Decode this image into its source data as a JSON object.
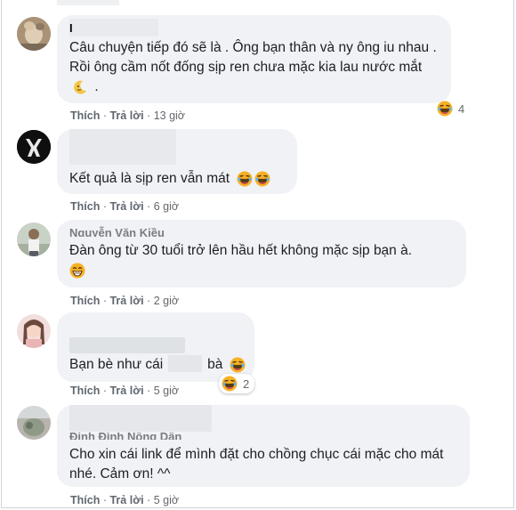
{
  "comments": [
    {
      "name": "I",
      "text": "Câu chuyện tiếp đó sẽ là . Ông bạn thân và ny ông iu nhau . Rồi ông cầm nốt đống sịp ren chưa mặc kia lau nước mắt",
      "text_after": ".",
      "like": "Thích",
      "reply": "Trả lời",
      "time": "13 giờ",
      "reaction_count": "4"
    },
    {
      "text": "Kết quả là sịp ren vẫn mát",
      "like": "Thích",
      "reply": "Trả lời",
      "time": "6 giờ"
    },
    {
      "name": "Nguyễn Văn Kiều",
      "text": "Đàn ông từ 30 tuổi trở lên hầu hết không mặc sịp bạn à.",
      "like": "Thích",
      "reply": "Trả lời",
      "time": "2 giờ"
    },
    {
      "text_before": "Bạn bè như cái",
      "text_after": "bà",
      "like": "Thích",
      "reply": "Trả lời",
      "time": "5 giờ",
      "reaction_count": "2"
    },
    {
      "name": "Đinh Đình Nông Dân",
      "text": "Cho xin cái link để mình đặt cho chồng chục cái mặc cho mát nhé. Cảm ơn! ^^",
      "like": "Thích",
      "reply": "Trả lời",
      "time": "5 giờ"
    }
  ],
  "separator": "·",
  "colors": {
    "bubble": "#f0f2f5",
    "meta": "#65676b",
    "text": "#1c1e21"
  }
}
